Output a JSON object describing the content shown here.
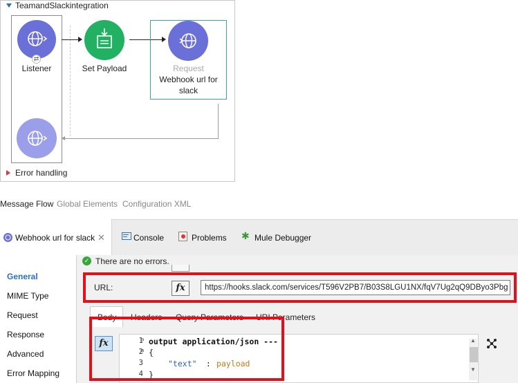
{
  "flow": {
    "name": "TeamandSlackintegration",
    "nodes": [
      {
        "label": "Listener",
        "icon": "globe-icon"
      },
      {
        "label": "Set Payload",
        "icon": "set-payload-icon"
      },
      {
        "type_label": "Request",
        "label_line1": "Webhook url for",
        "label_line2": "slack",
        "icon": "globe-icon"
      }
    ],
    "error_handling": "Error handling"
  },
  "view_tabs": [
    "Message Flow",
    "Global Elements",
    "Configuration XML"
  ],
  "editor_tabs": [
    {
      "label": "Webhook url for slack"
    },
    {
      "label": "Console"
    },
    {
      "label": "Problems"
    },
    {
      "label": "Mule Debugger"
    }
  ],
  "nav": [
    "General",
    "MIME Type",
    "Request",
    "Response",
    "Advanced",
    "Error Mapping"
  ],
  "status": "There are no errors.",
  "url": {
    "label": "URL:",
    "value": "https://hooks.slack.com/services/T596V2PB7/B03S8LGU1NX/fqV7Ug2qQ9DByo3Pbg"
  },
  "fx_label": "fx",
  "sub_tabs": [
    "Body",
    "Headers",
    "Query Parameters",
    "URI Parameters"
  ],
  "code": [
    {
      "n": "1",
      "text": "output application/json ---"
    },
    {
      "n": "2",
      "text": "{"
    },
    {
      "n": "3",
      "key": "\"text\"",
      "sep": " : ",
      "val": "payload"
    },
    {
      "n": "4",
      "text": "}"
    }
  ],
  "colors": {
    "accent": "#2d6fc0",
    "highlight": "#e0101d",
    "flow_node": "#6b6fd8",
    "transform_node": "#22b162"
  }
}
